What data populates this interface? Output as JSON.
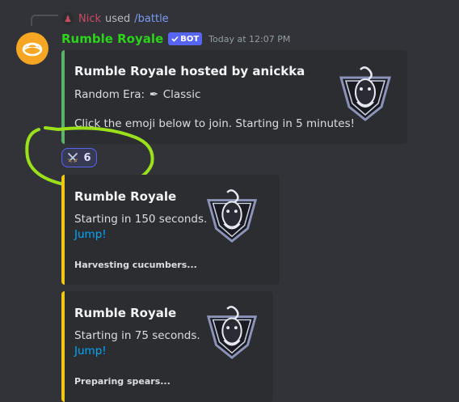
{
  "reply": {
    "user": "Nick",
    "action": "used",
    "command": "/battle"
  },
  "message": {
    "author": "Rumble Royale",
    "bot_tag": "BOT",
    "timestamp": "Today at 12:07 PM",
    "author_color": "#2dd31b"
  },
  "embeds": [
    {
      "title": "Rumble Royale hosted by anickka",
      "era_label": "Random Era:",
      "era_value": "Classic",
      "description": "Click the emoji below to join. Starting in 5 minutes!",
      "accent": "#5bb36a"
    },
    {
      "title": "Rumble Royale",
      "description": "Starting in 150 seconds.",
      "link": "Jump!",
      "footer": "Harvesting cucumbers...",
      "accent": "#f0c814"
    },
    {
      "title": "Rumble Royale",
      "description": "Starting in 75 seconds.",
      "link": "Jump!",
      "footer": "Preparing spears...",
      "accent": "#f0c814"
    }
  ],
  "reaction": {
    "emoji": "crossed-swords-icon",
    "count": "6"
  },
  "annotation": {
    "color": "#9be01b"
  }
}
